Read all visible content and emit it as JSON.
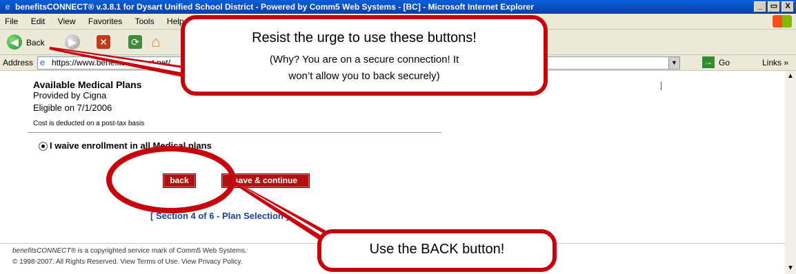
{
  "window": {
    "title": "benefitsCONNECT® v.3.8.1 for Dysart Unified School District - Powered by Comm5 Web Systems - [BC] - Microsoft Internet Explorer",
    "minimize_label": "_",
    "maximize_label": "▭",
    "close_label": "X"
  },
  "menu": {
    "items": [
      "File",
      "Edit",
      "View",
      "Favorites",
      "Tools",
      "Help"
    ]
  },
  "toolbar": {
    "back_label": "Back",
    "back_glyph": "◀",
    "forward_glyph": "▶",
    "stop_glyph": "✕",
    "refresh_glyph": "⟳",
    "home_glyph": "⌂"
  },
  "address": {
    "label": "Address",
    "url": "https://www.benefitsconnect.net/",
    "favicon_glyph": "e",
    "dropdown_glyph": "▼",
    "go_label": "Go",
    "go_glyph": "→",
    "links_label": "Links »"
  },
  "page": {
    "heading": "Available Medical Plans",
    "provider": "Provided by Cigna",
    "eligible": "Eligible on 7/1/2006",
    "cost_note": "Cost is deducted on a post-tax basis",
    "waive_label": "I waive enrollment in all Medical plans",
    "back_button": "back",
    "save_continue_button": "save & continue",
    "section_label": "[ Section 4 of 6 - Plan Selection ]",
    "footer": {
      "brand": "benefitsCONNECT®",
      "line1": "is a copyrighted service mark of Comm5 Web Systems.",
      "line2": "© 1998-2007.  All Rights Reserved.  View Terms of Use.  View Privacy Policy."
    }
  },
  "scrollbar": {
    "up_glyph": "▲",
    "down_glyph": "▼"
  },
  "annotations": {
    "top": {
      "main": "Resist the urge to use these buttons!",
      "sub1": "(Why?  You are on a secure connection!  It",
      "sub2": "won’t allow you to back securely)"
    },
    "bottom": {
      "main": "Use the BACK button!"
    }
  },
  "colors": {
    "accent_red": "#c8000b",
    "button_red": "#b01010",
    "link_blue": "#1a3fa0",
    "titlebar_blue": "#0b3fa8"
  }
}
